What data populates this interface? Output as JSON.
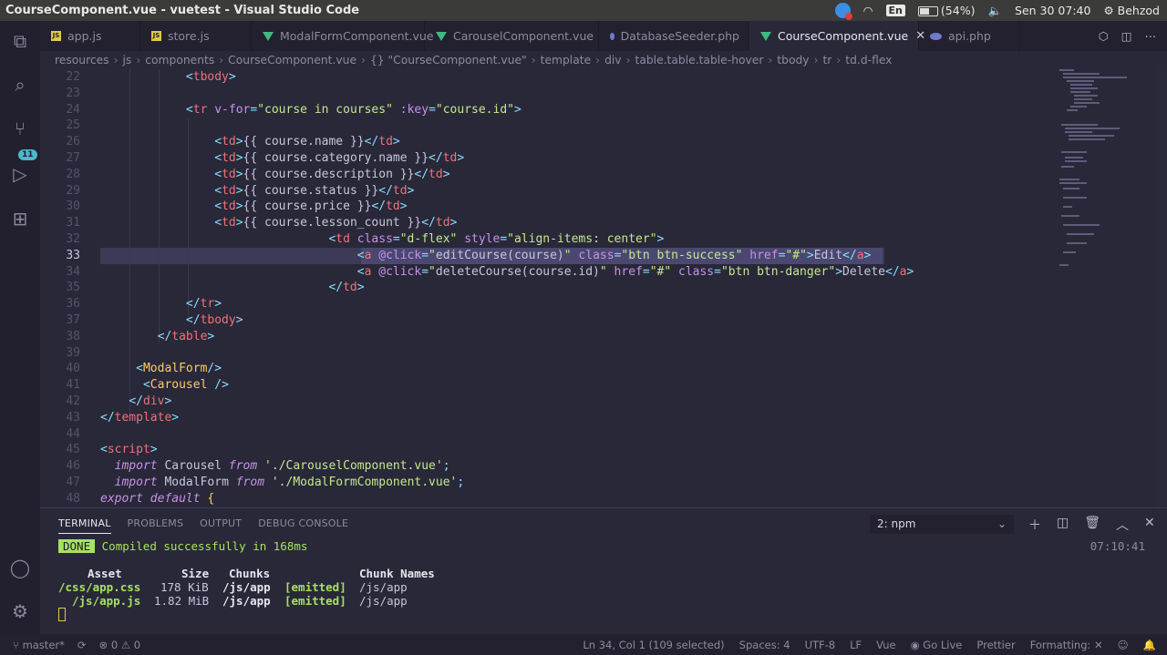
{
  "window": {
    "title": "CourseComponent.vue - vuetest - Visual Studio Code"
  },
  "system": {
    "battery": "(54%)",
    "lang": "En",
    "clock": "Sen 30 07:40",
    "user": "Behzod"
  },
  "activity": {
    "scm_badge": "11"
  },
  "tabs": [
    {
      "label": "app.js",
      "type": "js"
    },
    {
      "label": "store.js",
      "type": "js"
    },
    {
      "label": "ModalFormComponent.vue",
      "type": "vue"
    },
    {
      "label": "CarouselComponent.vue",
      "type": "vue"
    },
    {
      "label": "DatabaseSeeder.php",
      "type": "php"
    },
    {
      "label": "CourseComponent.vue",
      "type": "vue",
      "active": true
    },
    {
      "label": "api.php",
      "type": "php"
    }
  ],
  "breadcrumb": [
    "resources",
    "js",
    "components",
    "CourseComponent.vue",
    "{} \"CourseComponent.vue\"",
    "template",
    "div",
    "table.table.table-hover",
    "tbody",
    "tr",
    "td.d-flex"
  ],
  "code": {
    "line_numbers": [
      "22",
      "23",
      "24",
      "25",
      "26",
      "27",
      "28",
      "29",
      "30",
      "31",
      "32",
      "33",
      "34",
      "35",
      "36",
      "37",
      "38",
      "39",
      "40",
      "41",
      "42",
      "43",
      "44",
      "45",
      "46",
      "47",
      "48"
    ]
  },
  "panel": {
    "tabs": [
      "TERMINAL",
      "PROBLEMS",
      "OUTPUT",
      "DEBUG CONSOLE"
    ],
    "terminal_select": "2: npm",
    "done": "DONE",
    "compiled": "Compiled successfully in 168ms",
    "time": "07:10:41",
    "headers": [
      "Asset",
      "Size",
      "Chunks",
      "Chunk Names"
    ],
    "rows": [
      [
        "/css/app.css",
        "178 KiB",
        "/js/app",
        "[emitted]",
        "/js/app"
      ],
      [
        "/js/app.js",
        "1.82 MiB",
        "/js/app",
        "[emitted]",
        "/js/app"
      ]
    ]
  },
  "statusbar": {
    "branch": "master*",
    "problems": "0",
    "warnings": "0",
    "position": "Ln 34, Col 1 (109 selected)",
    "spaces": "Spaces: 4",
    "encoding": "UTF-8",
    "eol": "LF",
    "language": "Vue",
    "golive": "Go Live",
    "prettier": "Prettier",
    "formatting": "Formatting: ✕"
  }
}
